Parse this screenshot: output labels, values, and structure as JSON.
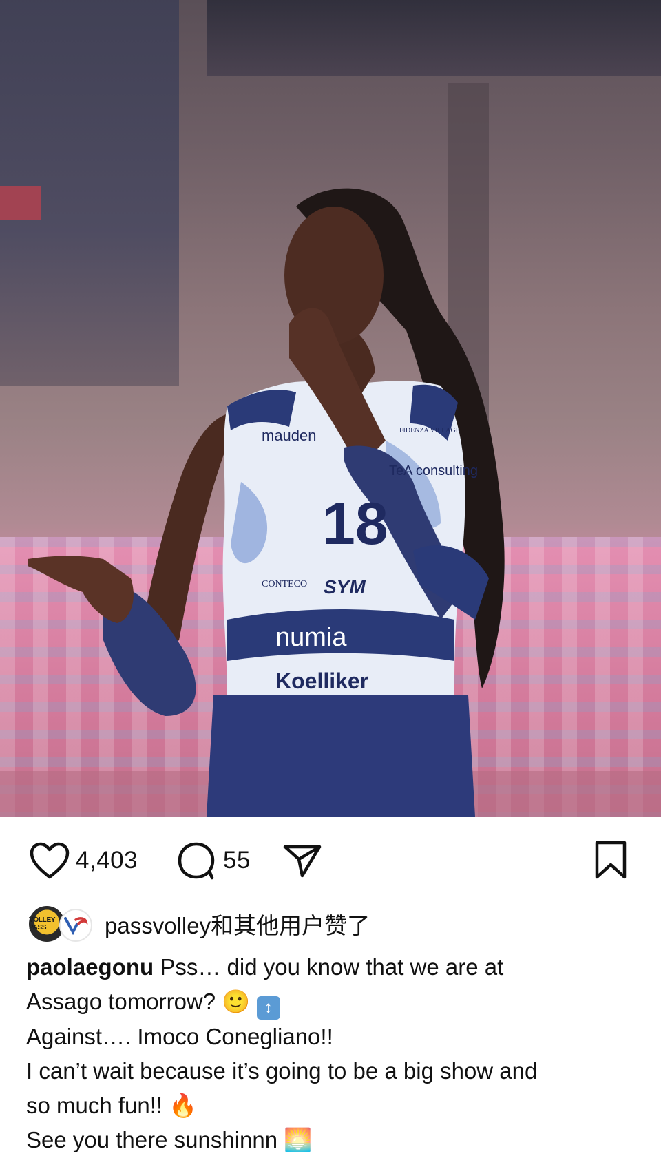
{
  "photo": {
    "jersey_number": "18",
    "sponsors": [
      "mauden",
      "FIDENZA VILLAGE",
      "TeA consulting",
      "CONTECO",
      "SYM",
      "numia",
      "Koelliker"
    ]
  },
  "actions": {
    "like_count": "4,403",
    "comment_count": "55"
  },
  "liked_by": {
    "avatar_label": "VOLLEY PASS",
    "text": "passvolley和其他用户赞了"
  },
  "caption": {
    "username": "paolaegonu",
    "line1": " Pss… did you know that we are at",
    "line2": "Assago tomorrow? ",
    "emoji_smile": "🙂",
    "emoji_updown": "↕",
    "line3": "Against…. Imoco Conegliano!!",
    "line4": "I can’t wait because it’s going to be a big show and",
    "line5": "so much fun!! ",
    "emoji_fire": "🔥",
    "line6": "See you there sunshinnn ",
    "emoji_sun": "🌅"
  },
  "icons": {
    "like": "heart-icon",
    "comment": "comment-bubble-icon",
    "share": "paper-plane-icon",
    "save": "bookmark-icon"
  }
}
